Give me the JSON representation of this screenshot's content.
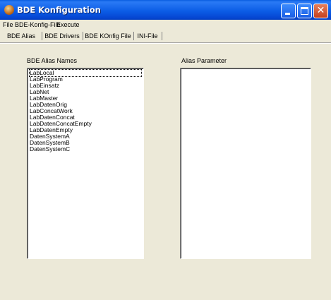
{
  "window": {
    "title": "BDE Konfiguration",
    "icon": "bde-app-icon",
    "controls": {
      "minimize": "minimize-icon",
      "maximize": "maximize-icon",
      "close": "close-icon",
      "close_glyph": "✕"
    }
  },
  "menu": {
    "items": [
      {
        "label": "File"
      },
      {
        "label": "BDE-Konfig-File"
      },
      {
        "label": "Execute"
      }
    ]
  },
  "tabs": [
    {
      "label": "BDE Alias",
      "active": true
    },
    {
      "label": "BDE Drivers",
      "active": false
    },
    {
      "label": "BDE KOnfig File",
      "active": false
    },
    {
      "label": "INI-File",
      "active": false
    }
  ],
  "alias_panel": {
    "label": "BDE Alias Names",
    "selected_index": 0,
    "items": [
      "LabLocal",
      "LabProgram",
      "LabEinsatz",
      "LabNet",
      "LabMaster",
      "LabDatenOrig",
      "LabConcatWork",
      "LabDatenConcat",
      "LabDatenConcatEmpty",
      "LabDatenEmpty",
      "DatenSystemA",
      "DatenSystemB",
      "DatenSystemC"
    ]
  },
  "param_panel": {
    "label": "Alias Parameter",
    "items": []
  }
}
